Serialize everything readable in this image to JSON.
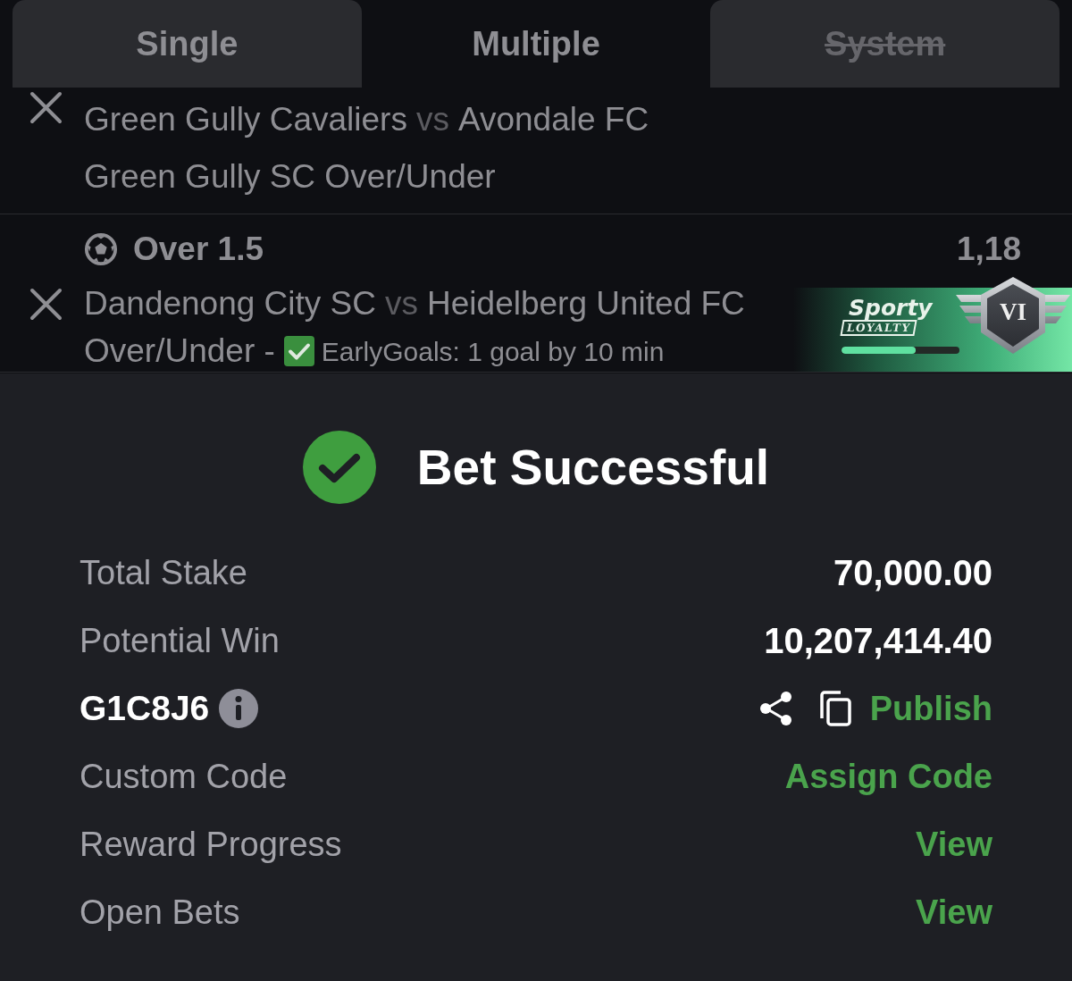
{
  "tabs": [
    {
      "label": "Single",
      "selected": false,
      "disabled": false
    },
    {
      "label": "Multiple",
      "selected": true,
      "disabled": false
    },
    {
      "label": "System",
      "selected": false,
      "disabled": true
    }
  ],
  "selections": [
    {
      "home": "Green Gully Cavaliers",
      "separator": "vs",
      "away": "Avondale FC",
      "market": "Green Gully SC Over/Under"
    },
    {
      "pick": "Over 1.5",
      "odds": "1,18",
      "home": "Dandenong City SC",
      "separator": "vs",
      "away": "Heidelberg United FC",
      "market": "Over/Under -",
      "promo": "EarlyGoals: 1 goal by 10 min"
    }
  ],
  "loyalty_banner": {
    "brand": "Sporty",
    "tagline": "LOYALTY",
    "tier": "VI",
    "level": 0.63
  },
  "confirmation": {
    "title": "Bet Successful",
    "rows": [
      {
        "kind": "amount",
        "label": "Total Stake",
        "value": "70,000.00"
      },
      {
        "kind": "amount",
        "label": "Potential Win",
        "value": "10,207,414.40"
      },
      {
        "kind": "code",
        "label": "G1C8J6",
        "action": "Publish"
      },
      {
        "kind": "link",
        "label": "Custom Code",
        "action": "Assign Code"
      },
      {
        "kind": "link",
        "label": "Reward Progress",
        "action": "View"
      },
      {
        "kind": "link",
        "label": "Open Bets",
        "action": "View"
      }
    ]
  }
}
